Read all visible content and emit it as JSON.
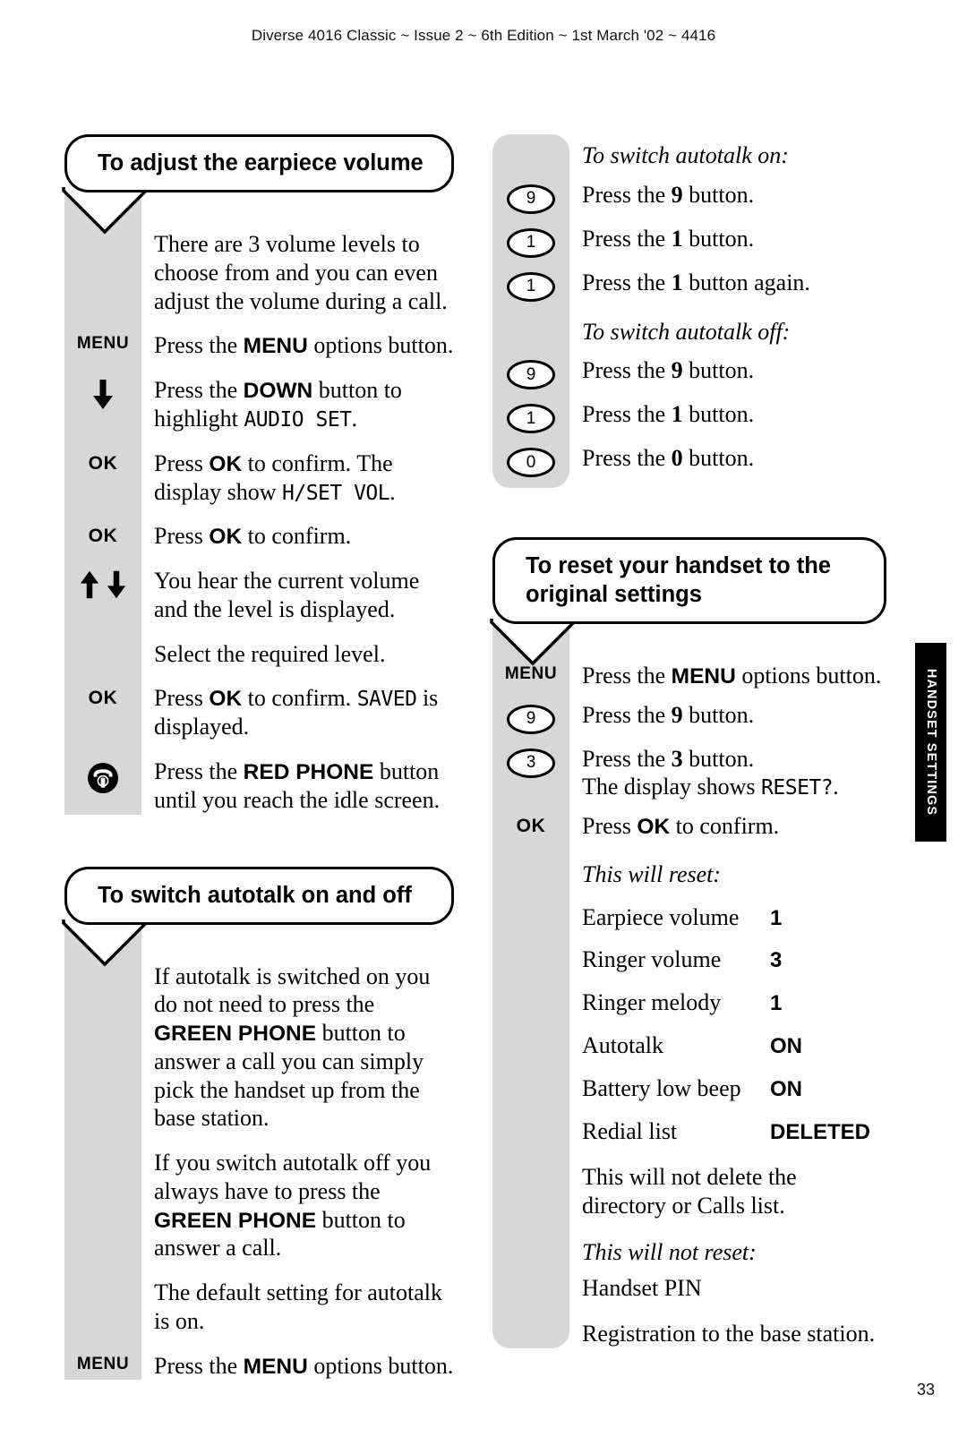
{
  "header": {
    "text": "Diverse 4016 Classic ~ Issue 2 ~ 6th Edition ~ 1st March '02 ~ 4416"
  },
  "page_number": "33",
  "side_tab": {
    "label": "HANDSET SETTINGS"
  },
  "keys": {
    "menu": "MENU",
    "ok": "OK",
    "d0": "0",
    "d1": "1",
    "d3": "3",
    "d9": "9"
  },
  "sections": {
    "earpiece_volume": {
      "title": "To adjust the earpiece volume",
      "steps": [
        {
          "key": "",
          "text": "There are 3 volume levels to choose from and you can even adjust the volume during a call."
        },
        {
          "key": "MENU",
          "text": "Press the MENU options button."
        },
        {
          "key": "down-arrow",
          "text": "Press the DOWN button to highlight AUDIO SET."
        },
        {
          "key": "OK",
          "text": "Press OK to confirm. The display show H/SET VOL."
        },
        {
          "key": "OK",
          "text": "Press OK to confirm."
        },
        {
          "key": "up-down-arrows",
          "text": "You hear the current volume and the level is displayed."
        },
        {
          "key": "",
          "text": "Select the required level."
        },
        {
          "key": "OK",
          "text": "Press OK to confirm. SAVED is displayed."
        },
        {
          "key": "red-phone",
          "text": "Press the RED PHONE button until you reach the idle screen."
        }
      ],
      "lcd_terms": [
        "AUDIO SET",
        "H/SET VOL",
        "SAVED"
      ]
    },
    "autotalk": {
      "title": "To switch autotalk on and off",
      "paragraphs": [
        "If autotalk is switched on you do not need to press the GREEN PHONE button to answer a call you can simply pick the handset up from the base station.",
        "If you switch autotalk off you always have to press the GREEN PHONE button to answer a call.",
        "The default setting for autotalk is on."
      ],
      "last_step": {
        "key": "MENU",
        "text": "Press the MENU options button."
      }
    },
    "autotalk_continued": {
      "on_heading": "To switch autotalk on:",
      "on_steps": [
        {
          "key": "9",
          "text": "Press the 9 button."
        },
        {
          "key": "1",
          "text": "Press the 1 button."
        },
        {
          "key": "1",
          "text": "Press the 1 button again."
        }
      ],
      "off_heading": "To switch autotalk off:",
      "off_steps": [
        {
          "key": "9",
          "text": "Press the 9 button."
        },
        {
          "key": "1",
          "text": "Press the 1 button."
        },
        {
          "key": "0",
          "text": "Press the 0 button."
        }
      ]
    },
    "reset": {
      "title": "To reset your handset to the original settings",
      "steps": [
        {
          "key": "MENU",
          "text": "Press the MENU options button."
        },
        {
          "key": "9",
          "text": "Press the 9 button."
        },
        {
          "key": "3",
          "text": "Press the 3 button. The display shows RESET?."
        },
        {
          "key": "OK",
          "text": "Press OK to confirm."
        }
      ],
      "will_reset_heading": "This will reset:",
      "will_reset": [
        {
          "label": "Earpiece volume",
          "value": "1"
        },
        {
          "label": "Ringer volume",
          "value": "3"
        },
        {
          "label": "Ringer melody",
          "value": "1"
        },
        {
          "label": "Autotalk",
          "value": "ON"
        },
        {
          "label": "Battery low beep",
          "value": "ON"
        },
        {
          "label": "Redial list",
          "value": "DELETED"
        }
      ],
      "note": "This will not delete the directory or Calls list.",
      "will_not_reset_heading": "This will not reset:",
      "will_not_reset": [
        "Handset PIN",
        "Registration to the base station."
      ]
    }
  },
  "fragments": {
    "press_the": "Press the ",
    "options_button": " options button.",
    "button_period": " button.",
    "button_again": " button again.",
    "press_sp": "Press ",
    "to_confirm": " to confirm.",
    "to_confirm_the": " to confirm. The",
    "display_show": "display show ",
    "period": ".",
    "down_btn_to": " button to",
    "highlight": "highlight ",
    "volume_intro_l1": "There are 3 volume levels to",
    "volume_intro_l2": "choose from and you can even",
    "volume_intro_l3": "adjust the volume during a call.",
    "hear_l1": "You hear the current volume",
    "hear_l2": "and the level is displayed.",
    "select_level": "Select the required level.",
    "is_displayed_1": " is",
    "is_displayed_2": "displayed.",
    "red_phone_l1_a": "Press the ",
    "red_phone_l1_b": " button",
    "red_phone_l2": "until you reach the idle screen.",
    "at_l1a": "If autotalk is switched on you",
    "at_l1b": "do not need to press the",
    "at_l1c": " button to",
    "at_l1d": "answer a call you can simply",
    "at_l1e": "pick the handset up from the",
    "at_l1f": "base station.",
    "at_l2a": "If you switch autotalk off you",
    "at_l2b": "always have to press the",
    "at_l2c": " button to",
    "at_l2d": "answer a call.",
    "at_l3a": "The default setting for autotalk",
    "at_l3b": "is on.",
    "reset_l1": "Press the ",
    "reset_l2": "The display shows ",
    "note_l1": "This will not delete the",
    "note_l2": "directory or Calls list."
  },
  "labels": {
    "MENU": "MENU",
    "OK": "OK",
    "DOWN": "DOWN",
    "RED_PHONE": "RED PHONE",
    "GREEN_PHONE": "GREEN PHONE",
    "AUDIO_SET": "AUDIO SET",
    "HSET_VOL": "H/SET VOL",
    "SAVED": "SAVED",
    "RESET_Q": "RESET?",
    "d9": "9",
    "d1": "1",
    "d0": "0",
    "d3": "3"
  },
  "colors": {
    "gutter": "#d7d7d7",
    "ink": "#000000",
    "tab_bg": "#000000",
    "tab_fg": "#ffffff"
  }
}
